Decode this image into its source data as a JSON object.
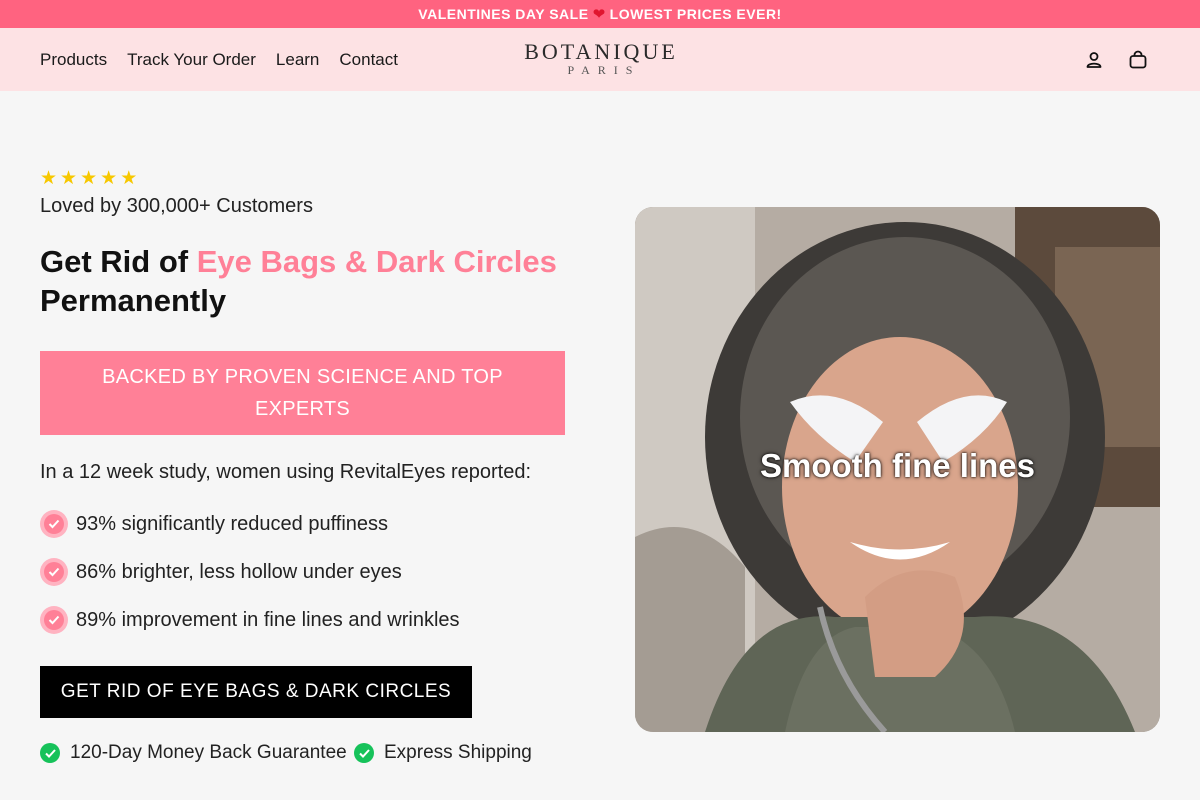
{
  "announcement": {
    "text_before": "VALENTINES DAY SALE",
    "text_after": "LOWEST PRICES EVER!"
  },
  "header": {
    "nav": [
      "Products",
      "Track Your Order",
      "Learn",
      "Contact"
    ],
    "logo_main": "BOTANIQUE",
    "logo_sub": "PARIS"
  },
  "hero": {
    "rating_stars": 5,
    "loved": "Loved by 300,000+ Customers",
    "headline_plain": "Get Rid of ",
    "headline_accent": "Eye Bags & Dark Circles",
    "headline_end": "Permanently",
    "backed": "BACKED BY PROVEN SCIENCE AND TOP EXPERTS",
    "study": "In a 12 week study, women using RevitalEyes reported:",
    "bullets": [
      "93% significantly reduced puffiness",
      "86% brighter, less hollow under eyes",
      "89% improvement in fine lines and wrinkles"
    ],
    "cta": "GET RID OF EYE BAGS & DARK CIRCLES",
    "guarantees": [
      "120-Day Money Back Guarantee",
      "Express Shipping"
    ],
    "image_caption": "Smooth fine lines"
  },
  "colors": {
    "announce_bg": "#ff6380",
    "header_bg": "#fde2e4",
    "accent_pink": "#ff8097",
    "star": "#f7c800",
    "check_green": "#16c25a"
  }
}
